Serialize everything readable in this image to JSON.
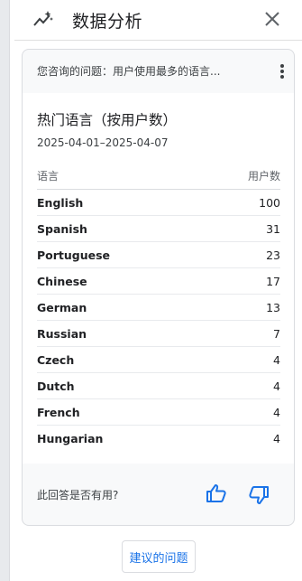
{
  "header": {
    "title": "数据分析",
    "icon": "sparkline-icon",
    "close_icon": "close-icon"
  },
  "card": {
    "question": "您咨询的问题：用户使用最多的语言...",
    "report_title": "热门语言（按用户数）",
    "date_range": "2025-04-01–2025-04-07",
    "columns": [
      "语言",
      "用户数"
    ],
    "rows": [
      {
        "language": "English",
        "users": "100"
      },
      {
        "language": "Spanish",
        "users": "31"
      },
      {
        "language": "Portuguese",
        "users": "23"
      },
      {
        "language": "Chinese",
        "users": "17"
      },
      {
        "language": "German",
        "users": "13"
      },
      {
        "language": "Russian",
        "users": "7"
      },
      {
        "language": "Czech",
        "users": "4"
      },
      {
        "language": "Dutch",
        "users": "4"
      },
      {
        "language": "French",
        "users": "4"
      },
      {
        "language": "Hungarian",
        "users": "4"
      }
    ],
    "feedback_question": "此回答是否有用?"
  },
  "suggest_button": "建议的问题",
  "colors": {
    "accent": "#1a73e8",
    "card_bg": "#f8f9fa",
    "border": "#dadce0"
  }
}
